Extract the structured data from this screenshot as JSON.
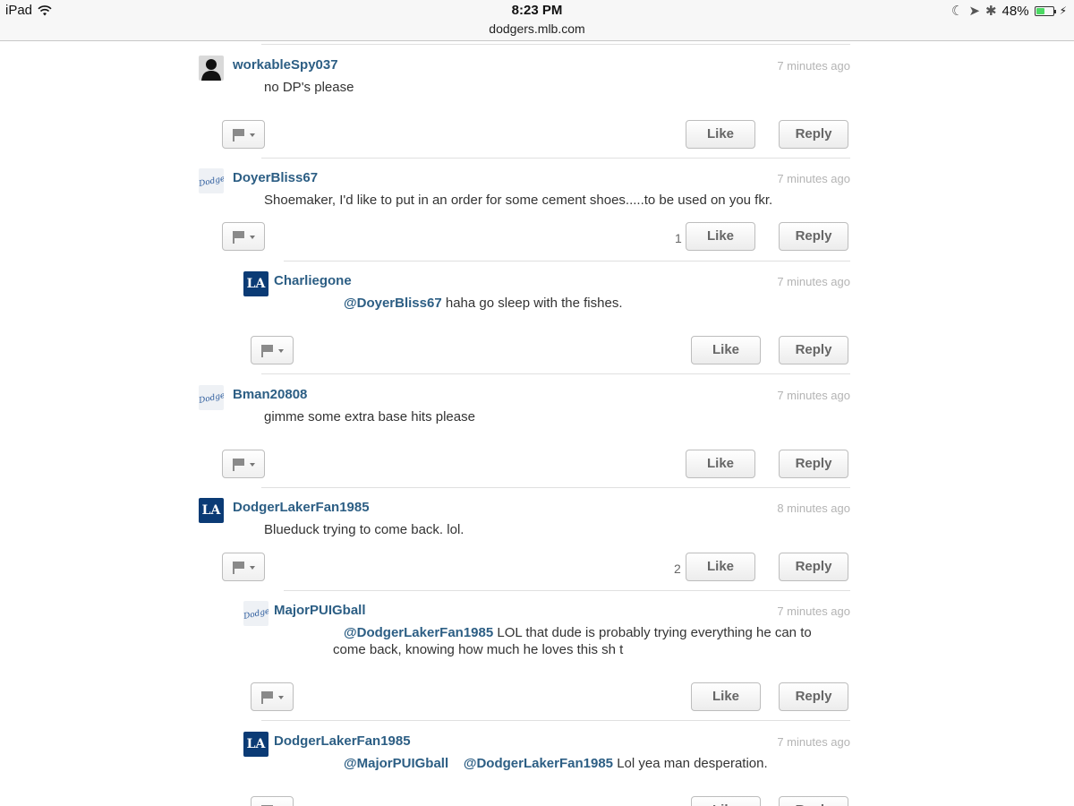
{
  "status_bar": {
    "device": "iPad",
    "time": "8:23 PM",
    "url": "dodgers.mlb.com",
    "battery": "48%",
    "battery_level": 0.48
  },
  "colors": {
    "username": "#2c5e84",
    "timestamp": "#b4b4b4",
    "avatar_la_bg": "#0b3b75"
  },
  "buttons": {
    "like": "Like",
    "reply": "Reply"
  },
  "comments": [
    {
      "user": "workableSpy037",
      "time": "7 minutes ago",
      "text": "no DP's please",
      "likes": "",
      "avatar": "silhouette-icon"
    },
    {
      "user": "DoyerBliss67",
      "time": "7 minutes ago",
      "text": "Shoemaker, I'd like to put in an order for some cement shoes.....to be used on you fkr.",
      "likes": "1",
      "avatar": "dodgers-script-logo-icon"
    },
    {
      "user": "Charliegone",
      "time": "7 minutes ago",
      "mention": "@DoyerBliss67",
      "text": " haha go sleep with the fishes.",
      "likes": "",
      "avatar": "la-logo-icon",
      "avatar_text": "LA"
    },
    {
      "user": "Bman20808",
      "time": "7 minutes ago",
      "text": "gimme some extra base hits please",
      "likes": "",
      "avatar": "dodgers-script-logo-icon"
    },
    {
      "user": "DodgerLakerFan1985",
      "time": "8 minutes ago",
      "text": "Blueduck trying to come back. lol.",
      "likes": "2",
      "avatar": "la-logo-icon",
      "avatar_text": "LA"
    },
    {
      "user": "MajorPUIGball",
      "time": "7 minutes ago",
      "mention": "@DodgerLakerFan1985",
      "text": " LOL that dude is probably trying everything he can to",
      "text2": "come back, knowing how much he loves this sh t",
      "likes": "",
      "avatar": "dodgers-script-logo-icon"
    },
    {
      "user": "DodgerLakerFan1985",
      "time": "7 minutes ago",
      "mention": "@MajorPUIGball",
      "mention2": "@DodgerLakerFan1985",
      "text": " Lol yea man desperation.",
      "likes": "",
      "avatar": "la-logo-icon",
      "avatar_text": "LA"
    }
  ],
  "logo_script_text": "Dodgers"
}
